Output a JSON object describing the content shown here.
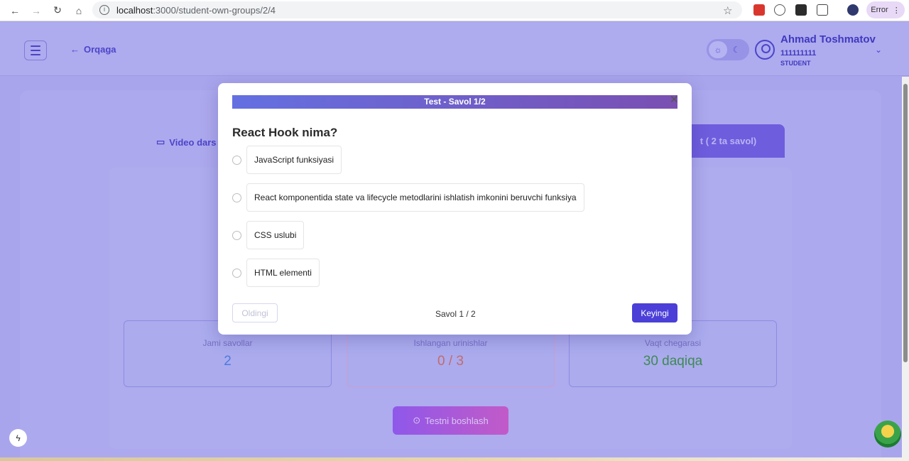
{
  "browser": {
    "url_host": "localhost",
    "url_path": ":3000/student-own-groups/2/4",
    "profile_label": "Error"
  },
  "header": {
    "back_label": "Orqaga",
    "user_name": "Ahmad Toshmatov",
    "user_id": "111111111",
    "user_role": "STUDENT"
  },
  "tabs": {
    "video_label": "Video dars",
    "test_label": "t (  2  ta savol)"
  },
  "stats": [
    {
      "label": "Jami savollar",
      "value": "2",
      "color": "#4e7bde"
    },
    {
      "label": "Ishlangan urinishlar",
      "value": "0 / 3",
      "color": "#c46b6b"
    },
    {
      "label": "Vaqt chegarasi",
      "value": "30 daqiqa",
      "color": "#3f8a52"
    }
  ],
  "start_button_label": "Testni boshlash",
  "modal": {
    "title": "Test - Savol 1/2",
    "question": "React Hook nima?",
    "options": [
      "JavaScript funksiyasi",
      "React komponentida state va lifecycle metodlarini ishlatish imkonini beruvchi funksiya",
      "CSS uslubi",
      "HTML elementi"
    ],
    "prev_label": "Oldingi",
    "counter": "Savol 1 / 2",
    "next_label": "Keyingi"
  },
  "colors": {
    "accent": "#4b3fd8",
    "overlay": "#a9a5ec"
  }
}
